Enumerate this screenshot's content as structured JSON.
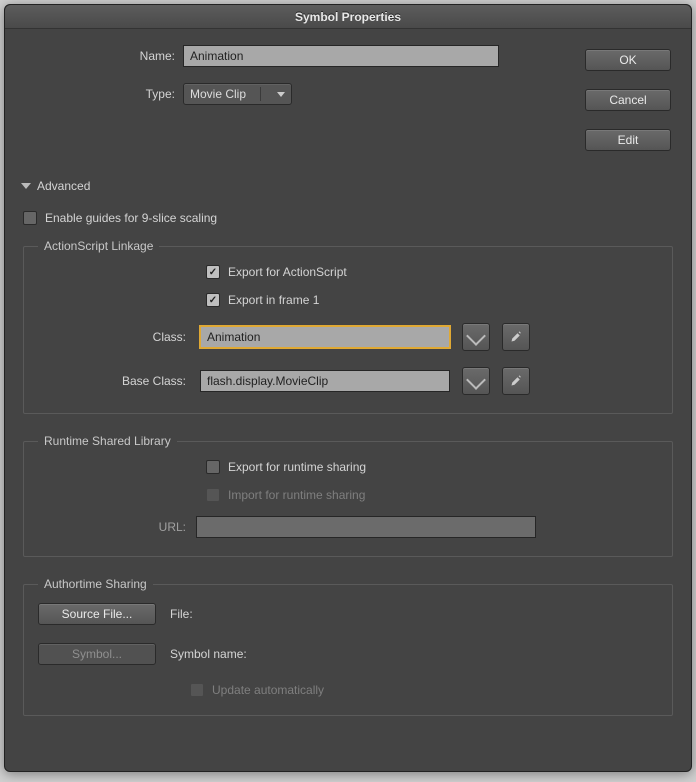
{
  "title": "Symbol Properties",
  "buttons": {
    "ok": "OK",
    "cancel": "Cancel",
    "edit": "Edit"
  },
  "name_label": "Name:",
  "name_value": "Animation",
  "type_label": "Type:",
  "type_value": "Movie Clip",
  "advanced_label": "Advanced",
  "nine_slice_label": "Enable guides for 9-slice scaling",
  "linkage": {
    "legend": "ActionScript Linkage",
    "export_as_label": "Export for ActionScript",
    "export_frame1_label": "Export in frame 1",
    "class_label": "Class:",
    "class_value": "Animation",
    "base_class_label": "Base Class:",
    "base_class_value": "flash.display.MovieClip"
  },
  "rsl": {
    "legend": "Runtime Shared Library",
    "export_label": "Export for runtime sharing",
    "import_label": "Import for runtime sharing",
    "url_label": "URL:",
    "url_value": ""
  },
  "auth": {
    "legend": "Authortime Sharing",
    "source_btn": "Source File...",
    "file_label": "File:",
    "symbol_btn": "Symbol...",
    "symbol_name_label": "Symbol name:",
    "update_auto_label": "Update automatically"
  }
}
